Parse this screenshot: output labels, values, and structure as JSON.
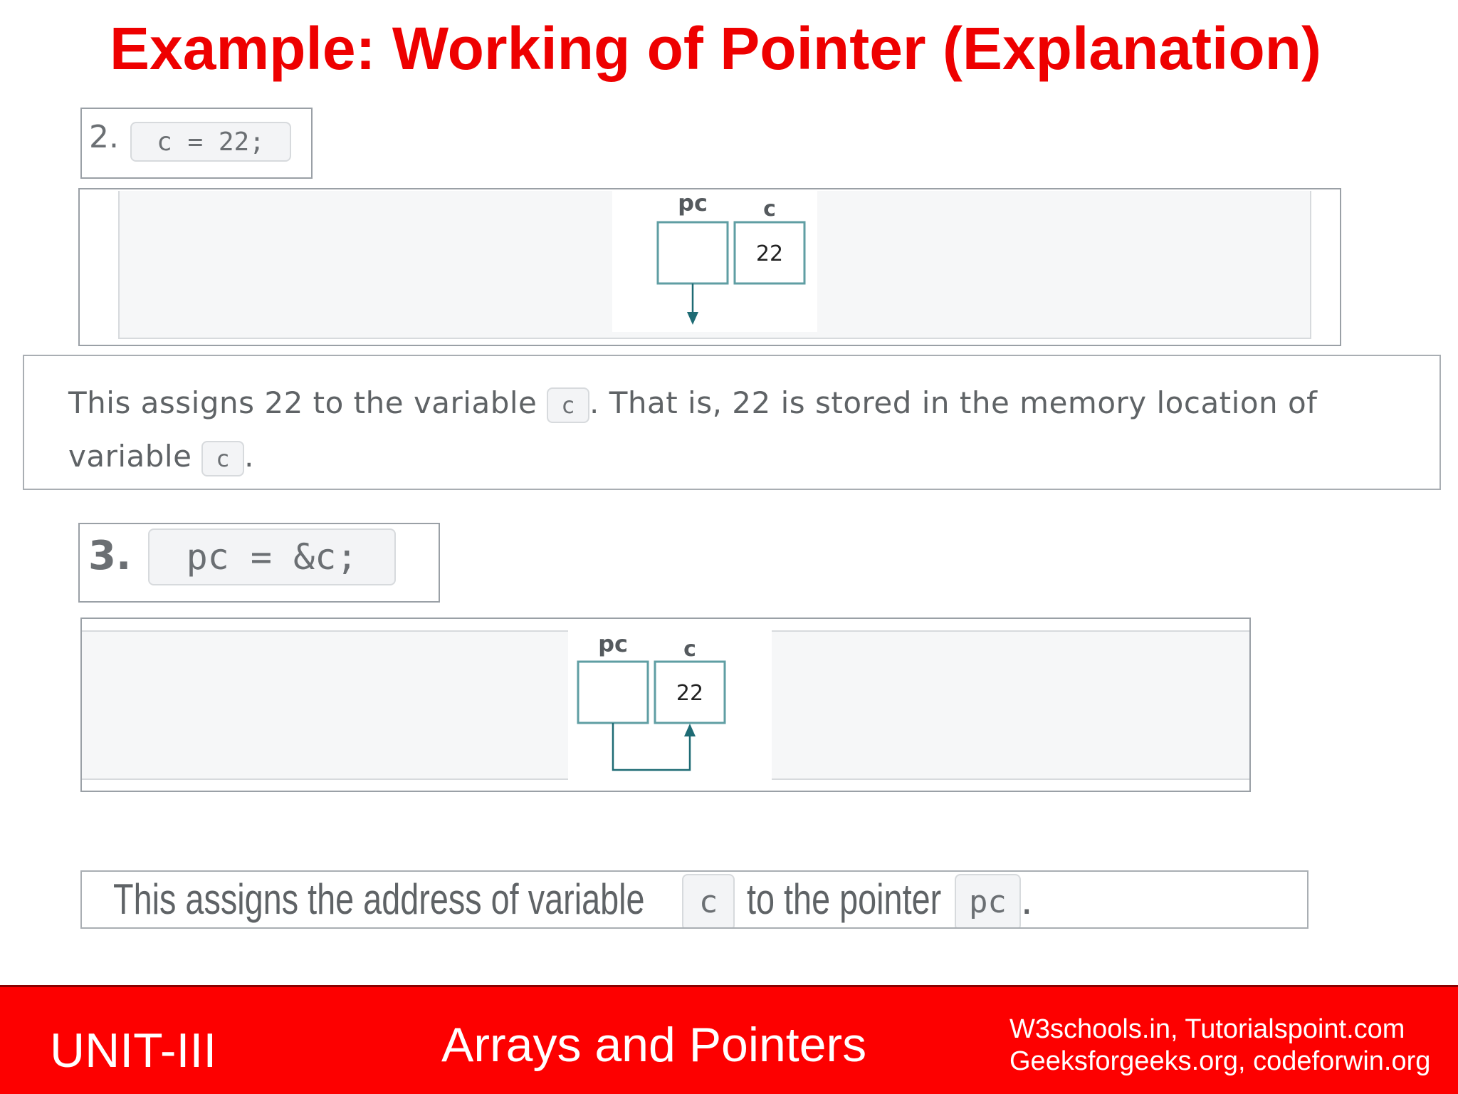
{
  "title": "Example: Working of  Pointer (Explanation)",
  "step2": {
    "number": "2.",
    "code": "c = 22;",
    "diagram": {
      "pointer_label": "pc",
      "var_label": "c",
      "var_value": "22"
    },
    "explanation": {
      "part1": "This assigns 22 to the variable",
      "chip1": "c",
      "part2": ". That is, 22 is stored in the memory location of",
      "part3": "variable",
      "chip2": "c",
      "part4": "."
    }
  },
  "step3": {
    "number": "3.",
    "code": "pc = &c;",
    "diagram": {
      "pointer_label": "pc",
      "var_label": "c",
      "var_value": "22"
    },
    "explanation": {
      "part1": "This assigns the address of variable",
      "chip1": "c",
      "part2": "to the pointer",
      "chip2": "pc",
      "part3": "."
    }
  },
  "footer": {
    "unit": "UNIT-III",
    "topic": "Arrays and Pointers",
    "sources_line1": "W3schools.in, Tutorialspoint.com",
    "sources_line2": "Geeksforgeeks.org, codeforwin.org"
  },
  "colors": {
    "title": "#ee0000",
    "footer_bg": "#fd0000",
    "diagram_teal": "#1e6b74"
  }
}
